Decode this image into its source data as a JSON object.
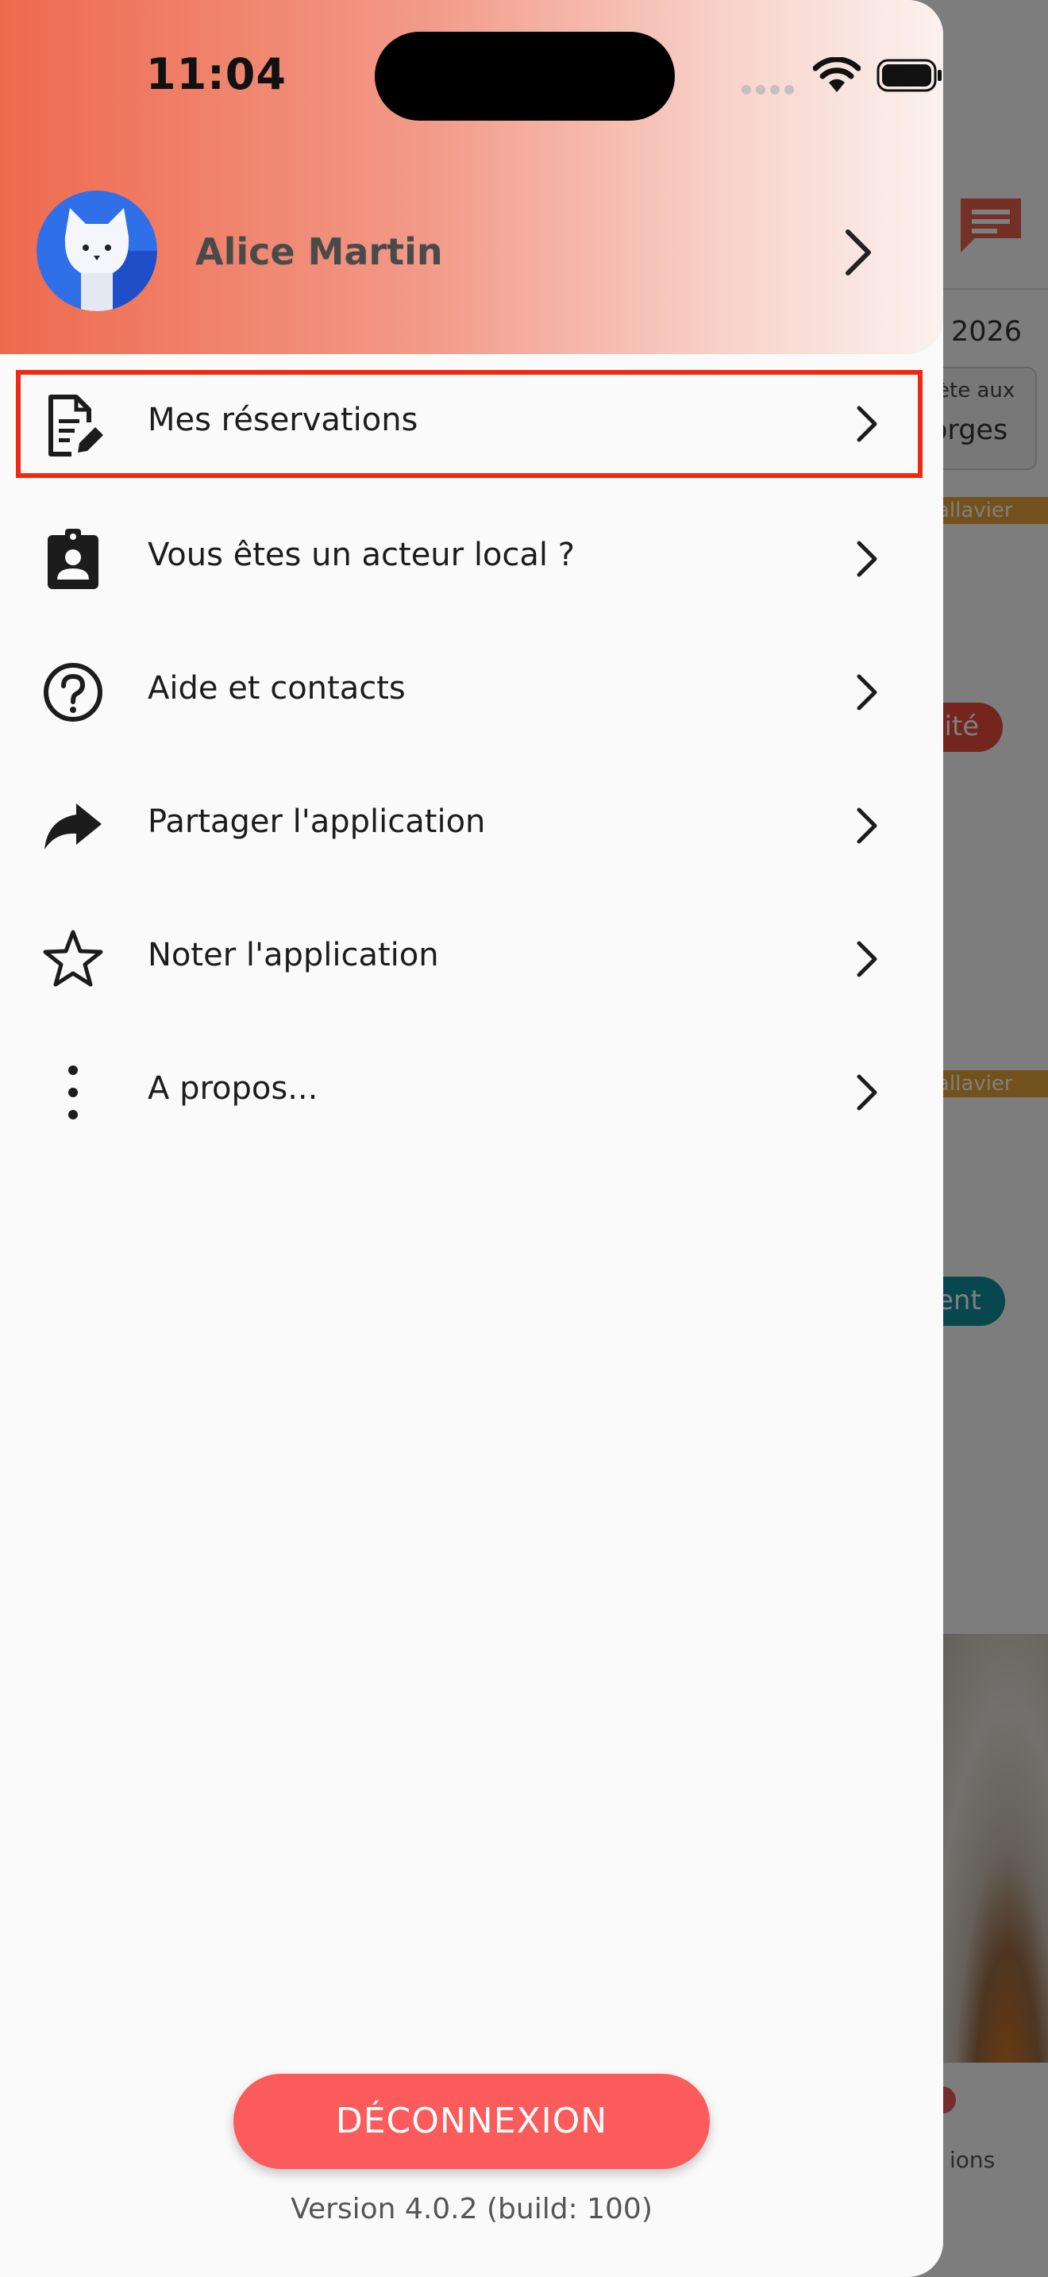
{
  "status_bar": {
    "time": "11:04"
  },
  "user": {
    "name": "Alice Martin",
    "avatar_icon": "cat-avatar-icon"
  },
  "menu": [
    {
      "label": "Mes réservations",
      "icon": "document-edit-icon",
      "selected": true
    },
    {
      "label": "Vous êtes un acteur local ?",
      "icon": "badge-id-icon",
      "selected": false
    },
    {
      "label": "Aide et contacts",
      "icon": "help-circle-icon",
      "selected": false
    },
    {
      "label": "Partager l'application",
      "icon": "share-arrow-icon",
      "selected": false
    },
    {
      "label": "Noter l'application",
      "icon": "star-outline-icon",
      "selected": false
    },
    {
      "label": "A propos...",
      "icon": "more-vertical-icon",
      "selected": false
    }
  ],
  "logout_label": "DÉCONNEXION",
  "version": "Version 4.0.2 (build: 100)",
  "background": {
    "date": "2026",
    "card_line1": "ète aux",
    "card_line2": "orges",
    "strip1": "allavier",
    "pill1": "lité",
    "strip2": "allavier",
    "pill2": "ent",
    "nav_label": "ions"
  },
  "colors": {
    "accent": "#fb5b5b",
    "header_gradient_start": "#ee6a4e",
    "highlight_outline": "#f02a12"
  }
}
